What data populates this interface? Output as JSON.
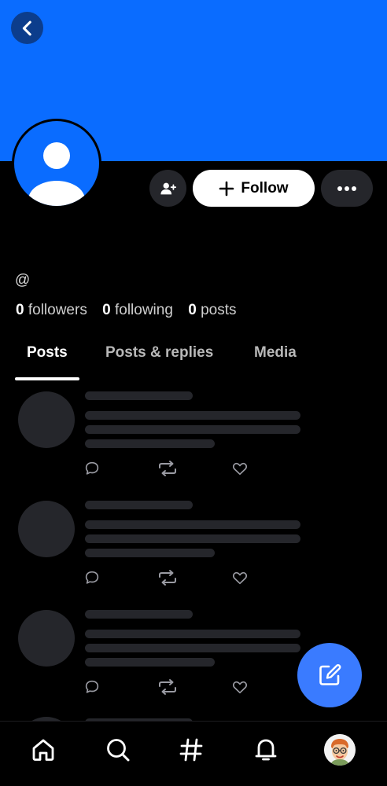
{
  "header": {
    "banner_color": "#0a6cff",
    "back_icon": "chevron-left-icon"
  },
  "profile": {
    "avatar_icon": "default-user-avatar",
    "handle": "@",
    "actions": {
      "add_user_icon": "user-plus-icon",
      "follow_label": "Follow",
      "more_icon": "ellipsis-icon"
    },
    "stats": {
      "followers_count": "0",
      "followers_label": "followers",
      "following_count": "0",
      "following_label": "following",
      "posts_count": "0",
      "posts_label": "posts"
    }
  },
  "tabs": [
    {
      "label": "Posts",
      "active": true
    },
    {
      "label": "Posts & replies",
      "active": false
    },
    {
      "label": "Media",
      "active": false
    }
  ],
  "feed": {
    "state": "loading-skeleton",
    "placeholder_posts": 3,
    "post_actions": [
      "reply-icon",
      "repost-icon",
      "like-icon"
    ]
  },
  "compose_button": {
    "icon": "compose-icon",
    "color": "#3a7bff"
  },
  "bottom_nav": {
    "items": [
      "home-icon",
      "search-icon",
      "feeds-hashtag-icon",
      "notifications-bell-icon",
      "profile-avatar"
    ]
  }
}
